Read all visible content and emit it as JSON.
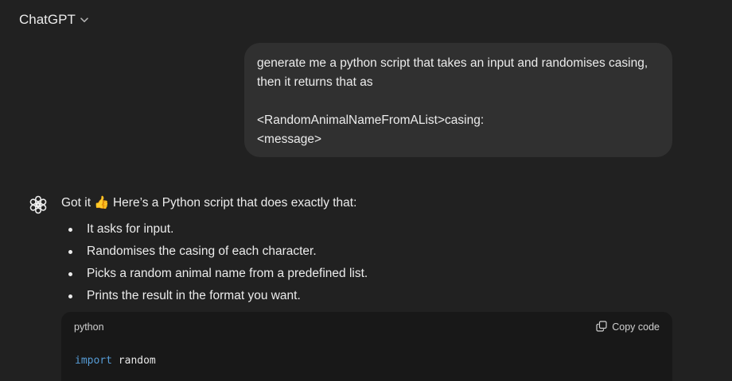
{
  "header": {
    "model_name": "ChatGPT",
    "chevron_icon": "chevron-down-icon"
  },
  "user_message": {
    "line1": "generate me a python script that takes an input and randomises casing,",
    "line2": "then it returns that as",
    "line3": "<RandomAnimalNameFromAList>casing:",
    "line4": "<message>"
  },
  "assistant": {
    "avatar_icon": "openai-logo-icon",
    "intro_before_emoji": "Got it ",
    "emoji": "👍",
    "intro_after_emoji": " Here’s a Python script that does exactly that:",
    "bullets": [
      "It asks for input.",
      "Randomises the casing of each character.",
      "Picks a random animal name from a predefined list.",
      "Prints the result in the format you want."
    ],
    "code_block": {
      "language": "python",
      "copy_label": "Copy code",
      "copy_icon": "copy-icon",
      "line1_keyword": "import",
      "line1_module": "random"
    }
  },
  "colors": {
    "background": "#212121",
    "user_bubble": "#303030",
    "code_background": "#181818",
    "keyword": "#569cd6",
    "text": "#ececec"
  }
}
